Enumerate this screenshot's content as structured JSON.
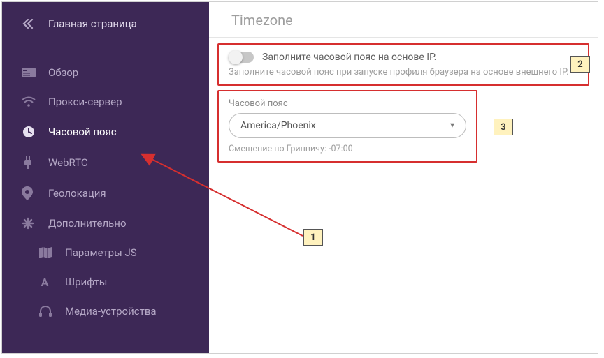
{
  "sidebar": {
    "home_label": "Главная страница",
    "items": [
      {
        "icon": "card-icon",
        "label": "Обзор"
      },
      {
        "icon": "wifi-icon",
        "label": "Прокси-сервер"
      },
      {
        "icon": "clock-icon",
        "label": "Часовой пояс",
        "active": true
      },
      {
        "icon": "plug-icon",
        "label": "WebRTC"
      },
      {
        "icon": "pin-icon",
        "label": "Геолокация"
      },
      {
        "icon": "asterisk-icon",
        "label": "Дополнительно"
      },
      {
        "icon": "map-icon",
        "label": "Параметры JS",
        "sub": true
      },
      {
        "icon": "font-icon",
        "label": "Шрифты",
        "sub": true
      },
      {
        "icon": "headphones-icon",
        "label": "Медиа-устройства",
        "sub": true
      }
    ]
  },
  "main": {
    "title": "Timezone",
    "toggle_label": "Заполните часовой пояс на основе IP.",
    "toggle_desc": "Заполните часовой пояс при запуске профиля браузера на основе внешнего IP.",
    "tz_field_label": "Часовой пояс",
    "tz_value": "America/Phoenix",
    "offset_label": "Смещение по Гринвичу:",
    "offset_value": "-07:00"
  },
  "callouts": {
    "c1": "1",
    "c2": "2",
    "c3": "3"
  }
}
